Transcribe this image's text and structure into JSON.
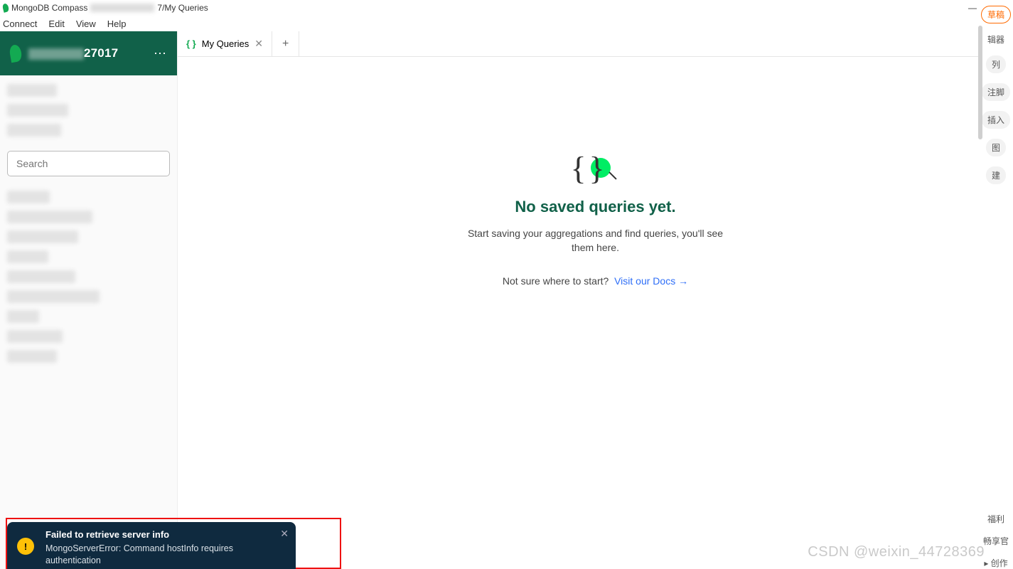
{
  "titlebar": {
    "app_name": "MongoDB Compass",
    "path_suffix": "7/My Queries"
  },
  "menubar": {
    "items": [
      "Connect",
      "Edit",
      "View",
      "Help"
    ]
  },
  "sidebar": {
    "host_display": "27017",
    "search_placeholder": "Search"
  },
  "tabs": {
    "active": {
      "label": "My Queries"
    }
  },
  "empty_state": {
    "heading": "No saved queries yet.",
    "subtext": "Start saving your aggregations and find queries, you'll see them here.",
    "prompt": "Not sure where to start?",
    "link_text": "Visit our Docs →"
  },
  "toast": {
    "title": "Failed to retrieve server info",
    "message": "MongoServerError: Command hostInfo requires authentication"
  },
  "right_panel": {
    "pill_top": "草稿",
    "label1": "辑器",
    "pill_a": "列",
    "pill_b": "注脚",
    "pill_c": "插入",
    "pill_d": "图",
    "pill_e": "建",
    "label2": "福利",
    "label3": "畅享官",
    "label4": "▸ 创作"
  },
  "watermark": "CSDN @weixin_44728369"
}
